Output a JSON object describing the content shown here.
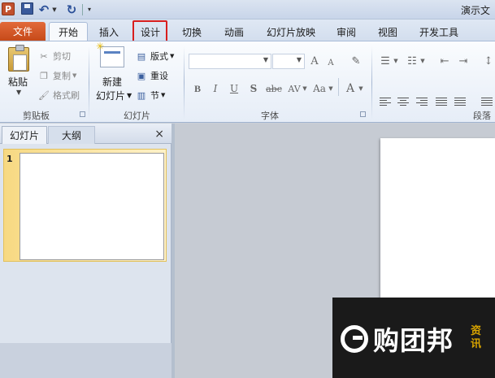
{
  "quick_access": {
    "app_icon": "P",
    "customize_glyph": "▾"
  },
  "title": "演示文",
  "tabs": [
    {
      "label": "文件"
    },
    {
      "label": "开始"
    },
    {
      "label": "插入"
    },
    {
      "label": "设计"
    },
    {
      "label": "切换"
    },
    {
      "label": "动画"
    },
    {
      "label": "幻灯片放映"
    },
    {
      "label": "审阅"
    },
    {
      "label": "视图"
    },
    {
      "label": "开发工具"
    }
  ],
  "highlight_color": "#d81e1e",
  "clipboard": {
    "paste": "粘贴",
    "cut": "剪切",
    "copy": "复制",
    "format_painter": "格式刷",
    "group_label": "剪贴板"
  },
  "slides_group": {
    "new_slide": "新建",
    "new_slide_line2": "幻灯片",
    "layout": "版式",
    "reset": "重设",
    "section": "节",
    "group_label": "幻灯片"
  },
  "font_group": {
    "grow": "A",
    "shrink": "A",
    "bold": "B",
    "italic": "I",
    "underline": "U",
    "shadow": "S",
    "strikethrough": "abc",
    "spacing": "AV",
    "case": "Aa",
    "color": "A",
    "group_label": "字体"
  },
  "paragraph_group": {
    "group_label": "段落"
  },
  "panel": {
    "tab_slides": "幻灯片",
    "tab_outline": "大纲",
    "close": "×",
    "thumb_number": "1"
  },
  "watermark": {
    "brand": "购团邦",
    "tag": "资讯"
  }
}
